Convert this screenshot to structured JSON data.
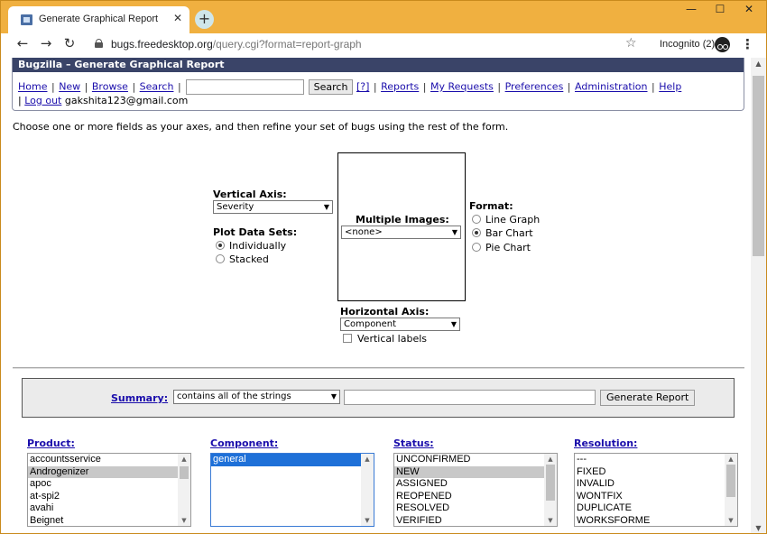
{
  "browser": {
    "tab_title": "Generate Graphical Report",
    "tab_close": "✕",
    "new_tab": "+",
    "url_host": "bugs.freedesktop.org",
    "url_rest": "/query.cgi?format=report-graph",
    "incognito_label": "Incognito (2)",
    "window_controls": [
      "—",
      "☐",
      "✕"
    ],
    "icons": [
      "back-icon",
      "forward-icon",
      "reload-icon",
      "lock-icon",
      "star-icon",
      "incognito-icon",
      "menu-icon"
    ]
  },
  "header": {
    "banner": "Bugzilla – Generate Graphical Report",
    "links": [
      "Home",
      "New",
      "Browse",
      "Search"
    ],
    "search_button": "Search",
    "help_short": "[?]",
    "links2": [
      "Reports",
      "My Requests",
      "Preferences",
      "Administration",
      "Help"
    ],
    "logout": "Log out",
    "user_email": "gakshita123@gmail.com"
  },
  "intro": "Choose one or more fields as your axes, and then refine your set of bugs using the rest of the form.",
  "axes": {
    "vertical_label": "Vertical Axis:",
    "vertical_value": "Severity",
    "plot_label": "Plot Data Sets:",
    "plot_options": [
      "Individually",
      "Stacked"
    ],
    "plot_selected": "Individually",
    "multiple_label": "Multiple Images:",
    "multiple_value": "<none>",
    "horizontal_label": "Horizontal Axis:",
    "horizontal_value": "Component",
    "vertical_labels": "Vertical labels",
    "format_label": "Format:",
    "format_options": [
      "Line Graph",
      "Bar Chart",
      "Pie Chart"
    ],
    "format_selected": "Bar Chart"
  },
  "summary": {
    "label": "Summary:",
    "mode": "contains all of the strings",
    "value": "",
    "generate_button": "Generate Report"
  },
  "fields": {
    "product": {
      "label": "Product:",
      "options": [
        "accountsservice",
        "Androgenizer",
        "apoc",
        "at-spi2",
        "avahi",
        "Beignet"
      ],
      "selected": "Androgenizer"
    },
    "component": {
      "label": "Component:",
      "options": [
        "general"
      ],
      "selected": "general"
    },
    "status": {
      "label": "Status:",
      "options": [
        "UNCONFIRMED",
        "NEW",
        "ASSIGNED",
        "REOPENED",
        "RESOLVED",
        "VERIFIED"
      ],
      "selected": "NEW"
    },
    "resolution": {
      "label": "Resolution:",
      "options": [
        "---",
        "FIXED",
        "INVALID",
        "WONTFIX",
        "DUPLICATE",
        "WORKSFORME"
      ],
      "selected": ""
    }
  },
  "colors": {
    "titlebar": "#f0b040",
    "banner": "#3a4468",
    "link": "#1a0dab",
    "focus_blue": "#1e70d8"
  }
}
